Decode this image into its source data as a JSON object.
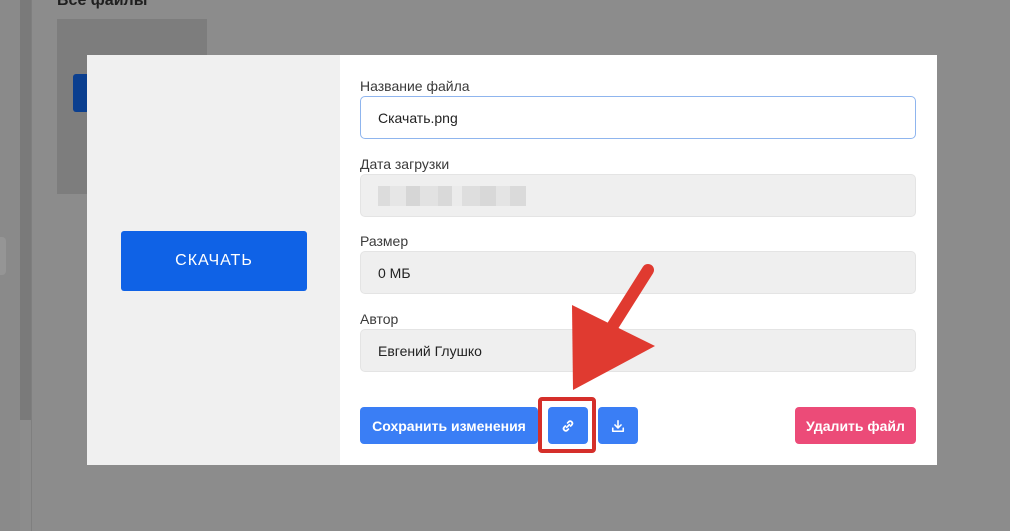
{
  "background": {
    "section_title": "Все файлы"
  },
  "modal": {
    "preview": {
      "download_label": "СКАЧАТЬ"
    },
    "fields": {
      "filename": {
        "label": "Название файла",
        "value": "Скачать.png"
      },
      "upload_date": {
        "label": "Дата загрузки",
        "value": ""
      },
      "size": {
        "label": "Размер",
        "value": "0 МБ"
      },
      "author": {
        "label": "Автор",
        "value": "Евгений Глушко"
      }
    },
    "actions": {
      "save_label": "Сохранить изменения",
      "copy_link_icon": "link-icon",
      "download_icon": "download-icon",
      "delete_label": "Удалить файл"
    }
  },
  "colors": {
    "primary": "#3a7ef5",
    "preview_button": "#0f62e6",
    "danger": "#ec4b78",
    "annotation": "#d52f2a"
  }
}
